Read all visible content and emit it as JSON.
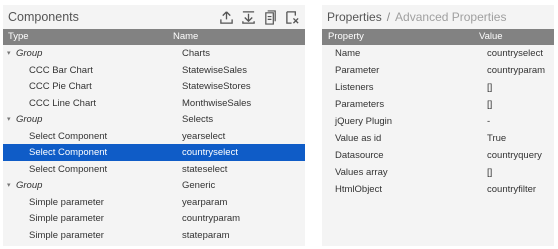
{
  "components": {
    "title": "Components",
    "toolbar": [
      {
        "name": "upload-icon"
      },
      {
        "name": "download-icon"
      },
      {
        "name": "document-icon"
      },
      {
        "name": "delete-icon"
      }
    ],
    "columns": {
      "type": "Type",
      "name": "Name"
    },
    "rows": [
      {
        "kind": "group",
        "type": "Group",
        "name": "Charts"
      },
      {
        "kind": "item",
        "type": "CCC Bar Chart",
        "name": "StatewiseSales"
      },
      {
        "kind": "item",
        "type": "CCC Pie Chart",
        "name": "StatewiseStores"
      },
      {
        "kind": "item",
        "type": "CCC Line Chart",
        "name": "MonthwiseSales"
      },
      {
        "kind": "group",
        "type": "Group",
        "name": "Selects"
      },
      {
        "kind": "item",
        "type": "Select Component",
        "name": "yearselect"
      },
      {
        "kind": "item",
        "type": "Select Component",
        "name": "countryselect",
        "selected": true
      },
      {
        "kind": "item",
        "type": "Select Component",
        "name": "stateselect"
      },
      {
        "kind": "group",
        "type": "Group",
        "name": "Generic"
      },
      {
        "kind": "item",
        "type": "Simple parameter",
        "name": "yearparam"
      },
      {
        "kind": "item",
        "type": "Simple parameter",
        "name": "countryparam"
      },
      {
        "kind": "item",
        "type": "Simple parameter",
        "name": "stateparam"
      }
    ]
  },
  "properties": {
    "title": "Properties",
    "separator": "/",
    "subtitle": "Advanced Properties",
    "columns": {
      "property": "Property",
      "value": "Value"
    },
    "rows": [
      {
        "property": "Name",
        "value": "countryselect"
      },
      {
        "property": "Parameter",
        "value": "countryparam"
      },
      {
        "property": "Listeners",
        "value": "[]"
      },
      {
        "property": "Parameters",
        "value": "[]"
      },
      {
        "property": "jQuery Plugin",
        "value": "-"
      },
      {
        "property": "Value as id",
        "value": "True"
      },
      {
        "property": "Datasource",
        "value": "countryquery"
      },
      {
        "property": "Values array",
        "value": "[]"
      },
      {
        "property": "HtmlObject",
        "value": "countryfilter"
      }
    ]
  },
  "colors": {
    "panel_bg": "#f4f4f4",
    "header_bar": "#828282",
    "selected_row": "#0f5cc7"
  }
}
